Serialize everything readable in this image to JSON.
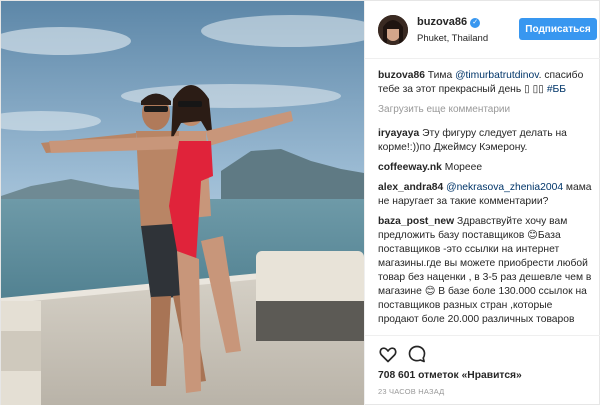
{
  "post": {
    "username": "buzova86",
    "verified_icon": "verified-badge-icon",
    "location": "Phuket, Thailand",
    "follow_label": "Подписаться",
    "load_more": "Загрузить еще комментарии",
    "caption": {
      "user": "buzova86",
      "text_before": " Тима ",
      "mention": "@timurbatrutdinov",
      "text_after": ". спасибо тебе за этот прекрасный день ▯ ▯▯ ",
      "tag": "#ББ"
    },
    "comments": [
      {
        "user": "iryayaya",
        "text": " Эту фигуру следует делать на корме!:))по Джеймсу Кэмерону."
      },
      {
        "user": "coffeeway.nk",
        "text": " Мореее"
      },
      {
        "user": "alex_andra84",
        "mention": " @nekrasova_zhenia2004",
        "text": " мама не наругает за такие комментарии?"
      },
      {
        "user": "baza_post_new",
        "text": " Здравствуйте хочу вам предложить базу поставщиков 😊База поставщиков -это ссылки на интернет магазины.где вы можете приобрести любой товар без наценки , в 3-5 раз дешевле чем в магазине 😊 В базе боле 130.000 ссылок на поставщиков разных стран ,которые продают боле 20.000 различных товаров"
      }
    ],
    "likes": "708 601 отметок «Нравится»",
    "time_ago": "23 ЧАСОВ НАЗАД",
    "icons": {
      "like": "heart-icon",
      "comment": "comment-icon"
    },
    "colors": {
      "accent": "#3897f0",
      "link": "#003569",
      "muted": "#999999"
    }
  }
}
